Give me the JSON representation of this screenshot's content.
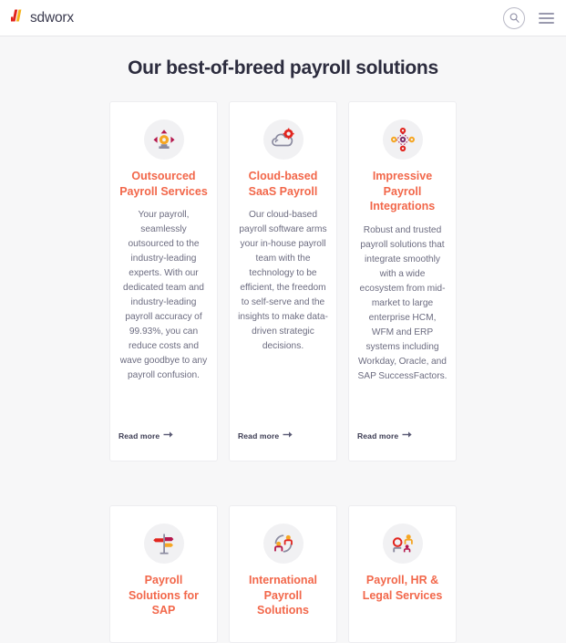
{
  "header": {
    "logo_text": "sdworx",
    "logo_icon": "sdworx-logo-mark",
    "search_icon": "search-icon",
    "menu_icon": "hamburger-menu-icon"
  },
  "page": {
    "title": "Our best-of-breed payroll solutions",
    "colors": {
      "accent": "#f2674a",
      "background": "#f7f7f8",
      "card_background": "#ffffff",
      "title": "#2c2c3e",
      "body_text": "#6c6c80",
      "icon_circle": "#f1f1f3",
      "logo_red": "#e2251e",
      "logo_yellow": "#f6b31a",
      "icon_crimson": "#b5174c",
      "icon_orange": "#f5a623",
      "icon_gray": "#8b8ba0",
      "icon_purple": "#7b2d6b",
      "icon_red": "#e2251e"
    }
  },
  "cards": [
    {
      "icon": "outsourced-gear-arrows-icon",
      "title": "Outsourced Payroll Services",
      "body": "Your payroll, seamlessly outsourced to the industry-leading experts. With our dedicated team and industry-leading payroll accuracy of 99.93%, you can reduce costs and wave goodbye to any payroll confusion.",
      "read_more": "Read more"
    },
    {
      "icon": "cloud-gear-icon",
      "title": "Cloud-based SaaS Payroll",
      "body": "Our cloud-based payroll software arms your in-house payroll team with the technology to be efficient, the freedom to self-serve and the insights to make data-driven strategic decisions.",
      "read_more": "Read more"
    },
    {
      "icon": "network-nodes-icon",
      "title": "Impressive Payroll Integrations",
      "body": "Robust and trusted payroll solutions that integrate smoothly with a wide ecosystem from mid-market to large enterprise HCM, WFM and ERP systems including Workday, Oracle, and SAP SuccessFactors.",
      "read_more": "Read more"
    }
  ],
  "cards_row2": [
    {
      "icon": "signpost-icon",
      "title": "Payroll Solutions for SAP"
    },
    {
      "icon": "global-people-icon",
      "title": "International Payroll Solutions"
    },
    {
      "icon": "people-group-icon",
      "title": "Payroll, HR & Legal Services"
    }
  ]
}
